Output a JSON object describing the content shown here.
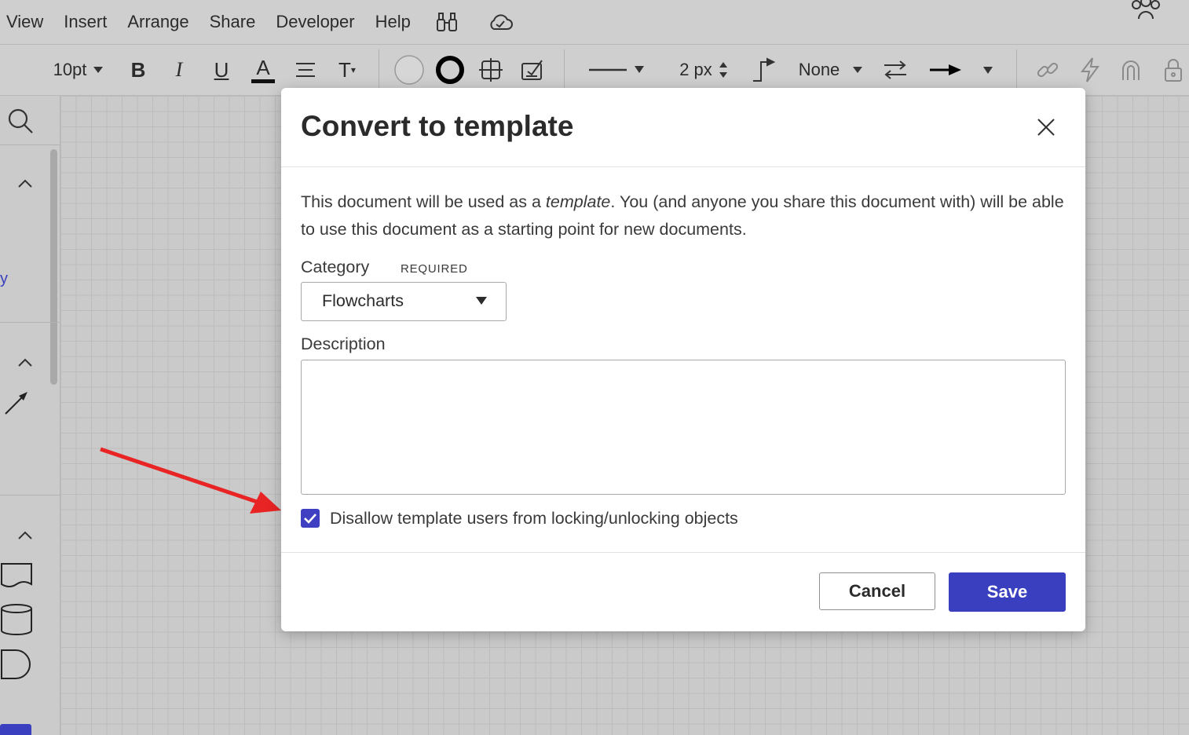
{
  "menu": {
    "items": [
      "View",
      "Insert",
      "Arrange",
      "Share",
      "Developer",
      "Help"
    ],
    "icons": [
      "binoculars-icon",
      "cloud-icon",
      "users-icon"
    ]
  },
  "toolbar": {
    "font_size": "10pt",
    "line_width": "2 px",
    "arrow_start": "None",
    "text_color": "#111111"
  },
  "dialog": {
    "title": "Convert to template",
    "description_pre": "This document will be used as a ",
    "description_em": "template",
    "description_post": ". You (and anyone you share this document with) will be able to use this document as a starting point for new documents.",
    "category_label": "Category",
    "category_required": "REQUIRED",
    "category_value": "Flowcharts",
    "description_label": "Description",
    "description_value": "",
    "checkbox_label": "Disallow template users from locking/unlocking objects",
    "checkbox_checked": true,
    "cancel_label": "Cancel",
    "save_label": "Save",
    "accent_color": "#3a3fc0"
  },
  "left_panel": {
    "partial_text": "y"
  },
  "annotation": {
    "arrow_color": "#e82424"
  }
}
